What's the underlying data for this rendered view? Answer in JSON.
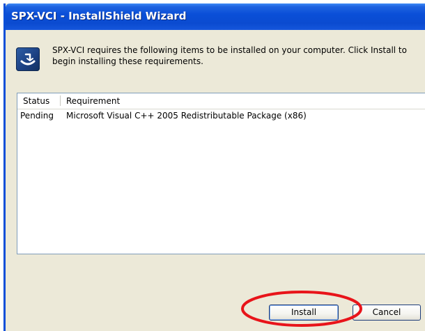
{
  "window": {
    "title": "SPX-VCI - InstallShield Wizard"
  },
  "header": {
    "icon": "installer-box-icon",
    "message": "SPX-VCI requires the following items to be installed on your computer. Click Install to begin installing these requirements."
  },
  "requirements": {
    "columns": [
      "Status",
      "Requirement"
    ],
    "rows": [
      {
        "status": "Pending",
        "requirement": "Microsoft Visual C++ 2005 Redistributable Package (x86)"
      }
    ]
  },
  "buttons": {
    "install_label": "Install",
    "cancel_label": "Cancel"
  },
  "colors": {
    "titlebar": "#0a4fd8",
    "dialog_background": "#ece9d8",
    "highlight_ellipse": "#e8141a"
  }
}
